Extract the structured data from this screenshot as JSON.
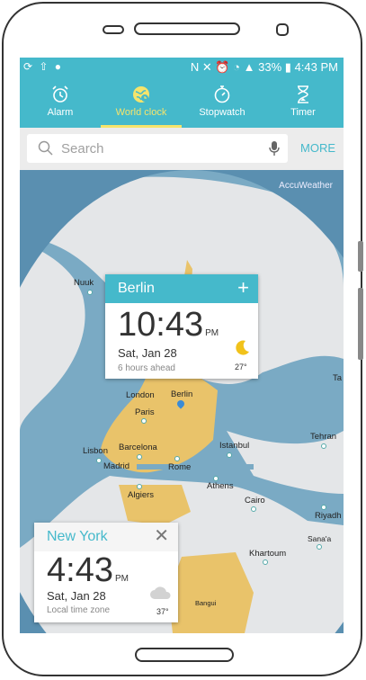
{
  "status_bar": {
    "left_icons": "⟳ ⇧ ●",
    "right_icons": "N ✕ ⏰ ◔ ▲",
    "battery": "33%",
    "time": "4:43 PM"
  },
  "tabs": [
    {
      "label": "Alarm",
      "icon": "alarm-icon",
      "active": false
    },
    {
      "label": "World clock",
      "icon": "globe-clock-icon",
      "active": true
    },
    {
      "label": "Stopwatch",
      "icon": "stopwatch-icon",
      "active": false
    },
    {
      "label": "Timer",
      "icon": "hourglass-icon",
      "active": false
    }
  ],
  "search": {
    "placeholder": "Search",
    "more_label": "MORE"
  },
  "map": {
    "provider": "AccuWeather",
    "cities": [
      "Nuuk",
      "London",
      "Berlin",
      "Paris",
      "Lisbon",
      "Barcelona",
      "Madrid",
      "Rome",
      "Istanbul",
      "Tehran",
      "Athens",
      "Algiers",
      "Cairo",
      "Riyadh",
      "Sana'a",
      "Khartoum",
      "Bangui",
      "Ta"
    ]
  },
  "berlin_card": {
    "city": "Berlin",
    "time": "10:43",
    "ampm": "PM",
    "date": "Sat, Jan 28",
    "offset": "6 hours ahead",
    "temp": "27°",
    "weather_icon": "moon-icon"
  },
  "ny_card": {
    "city": "New York",
    "time": "4:43",
    "ampm": "PM",
    "date": "Sat, Jan 28",
    "offset": "Local time zone",
    "temp": "37°",
    "weather_icon": "cloud-icon"
  },
  "colors": {
    "accent": "#45b9cb",
    "active_tab": "#f5e46b",
    "ocean": "#5a8fb0",
    "land": "#e2e4e6",
    "highlight_land": "#e9c36a"
  }
}
